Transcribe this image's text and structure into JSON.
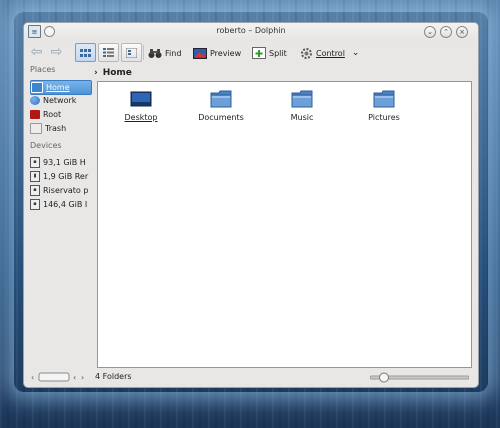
{
  "window": {
    "title": "roberto – Dolphin"
  },
  "toolbar": {
    "find": "Find",
    "preview": "Preview",
    "split": "Split",
    "control": "Control"
  },
  "places": {
    "title": "Places",
    "items": [
      {
        "label": "Home",
        "icon": "home-folder-icon",
        "color": "#3a86d1",
        "selected": true
      },
      {
        "label": "Network",
        "icon": "network-globe-icon",
        "color": "#2f6fb8"
      },
      {
        "label": "Root",
        "icon": "root-folder-icon",
        "color": "#b01818"
      },
      {
        "label": "Trash",
        "icon": "trash-icon",
        "color": "#d8d8d8"
      }
    ]
  },
  "devices": {
    "title": "Devices",
    "items": [
      {
        "label": "93,1 GiB H"
      },
      {
        "label": "1,9 GiB Rer"
      },
      {
        "label": "Riservato p"
      },
      {
        "label": "146,4 GiB I"
      }
    ]
  },
  "breadcrumb": {
    "current": "Home"
  },
  "folders": [
    {
      "label": "Desktop",
      "icon": "desktop-folder-icon"
    },
    {
      "label": "Documents",
      "icon": "folder-icon"
    },
    {
      "label": "Music",
      "icon": "folder-icon"
    },
    {
      "label": "Pictures",
      "icon": "folder-icon"
    }
  ],
  "status": {
    "text": "4 Folders"
  },
  "colors": {
    "accent": "#4e93d8",
    "content_border": "#6b9fd6",
    "folder": "#5b8fc8"
  }
}
